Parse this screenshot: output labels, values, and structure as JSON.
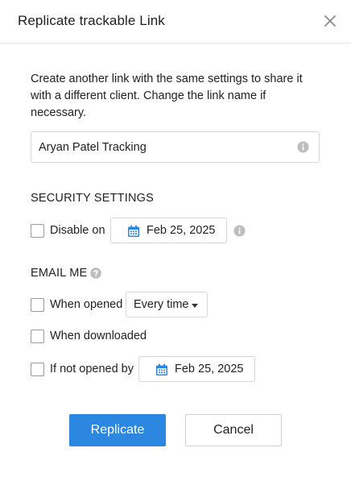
{
  "dialog": {
    "title": "Replicate trackable Link",
    "close_icon": "close-icon"
  },
  "description": "Create another link with the same settings to share it with a different client. Change the link name if necessary.",
  "link_name": {
    "value": "Aryan Patel Tracking",
    "info_icon": "info-icon"
  },
  "security": {
    "heading": "SECURITY SETTINGS",
    "disable_on": {
      "label": "Disable on",
      "checked": false,
      "date": "Feb 25, 2025",
      "calendar_icon": "calendar-icon",
      "info_icon": "info-icon"
    }
  },
  "email_me": {
    "heading": "EMAIL ME",
    "help_icon": "help-icon",
    "when_opened": {
      "label": "When opened",
      "checked": false,
      "frequency": "Every time",
      "caret_icon": "caret-down-icon"
    },
    "when_downloaded": {
      "label": "When downloaded",
      "checked": false
    },
    "if_not_opened_by": {
      "label": "If not opened by",
      "checked": false,
      "date": "Feb 25, 2025",
      "calendar_icon": "calendar-icon"
    }
  },
  "actions": {
    "replicate_label": "Replicate",
    "cancel_label": "Cancel"
  },
  "colors": {
    "primary": "#2b87e0",
    "calendar": "#2b87e0",
    "icon_grey": "#bdbdbd",
    "border": "#d6d6d6"
  }
}
